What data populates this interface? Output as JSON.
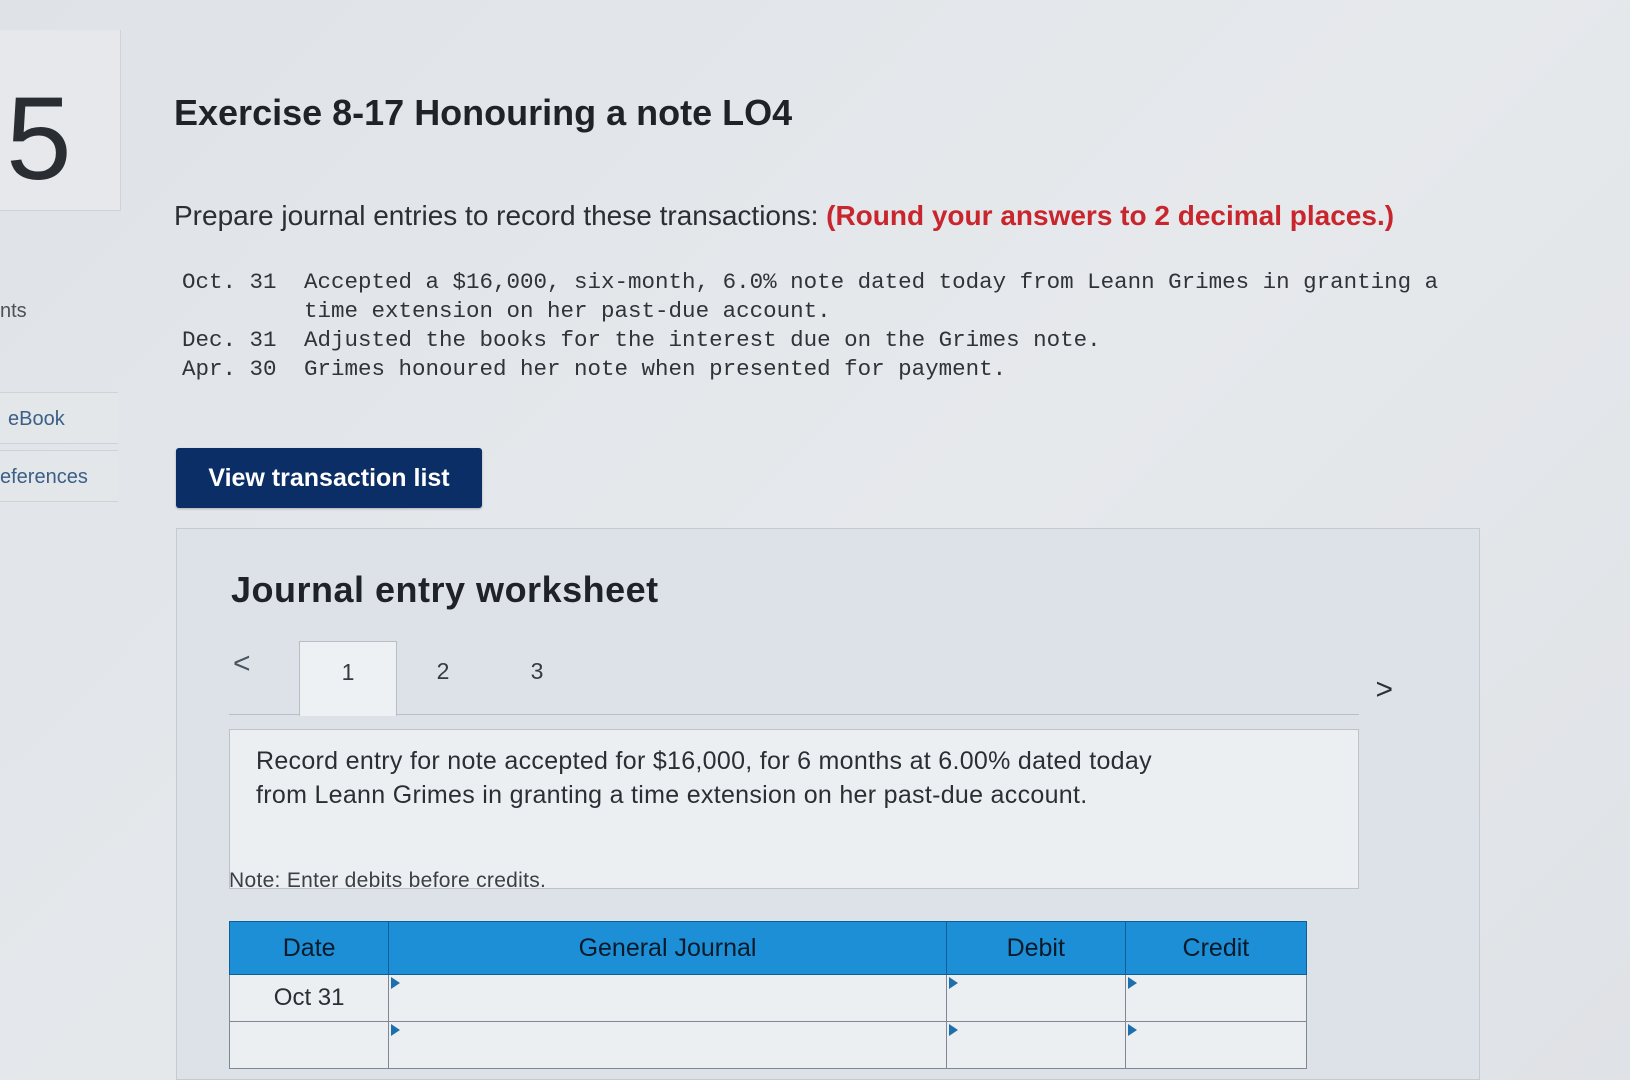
{
  "rail": {
    "question_number": "5",
    "points_label": "nts",
    "ebook_label": "eBook",
    "references_label": "eferences"
  },
  "header": {
    "title": "Exercise 8-17 Honouring a note LO4",
    "instruction": "Prepare journal entries to record these transactions:",
    "instruction_emphasis": "(Round your answers to 2 decimal places.)"
  },
  "transactions": [
    {
      "date": "Oct. 31",
      "description": "Accepted a $16,000, six-month, 6.0% note dated today from Leann Grimes in granting a time extension on her past-due account."
    },
    {
      "date": "Dec. 31",
      "description": "Adjusted the books for the interest due on the Grimes note."
    },
    {
      "date": "Apr. 30",
      "description": "Grimes honoured her note when presented for payment."
    }
  ],
  "buttons": {
    "view_transaction_list": "View transaction list"
  },
  "worksheet": {
    "title": "Journal entry worksheet",
    "prev_icon": "<",
    "next_icon": ">",
    "tabs": [
      "1",
      "2",
      "3"
    ],
    "active_tab": "1",
    "entry_instruction": "Record entry for note accepted for $16,000, for 6 months at 6.00% dated today from Leann Grimes in granting a time extension on her past-due account.",
    "note": "Note: Enter debits before credits.",
    "table": {
      "headers": [
        "Date",
        "General Journal",
        "Debit",
        "Credit"
      ],
      "rows": [
        {
          "date": "Oct 31",
          "account": "",
          "debit": "",
          "credit": ""
        },
        {
          "date": "",
          "account": "",
          "debit": "",
          "credit": ""
        }
      ]
    }
  },
  "colors": {
    "accent_red": "#c8252c",
    "button_navy": "#0c2e66",
    "table_header_blue": "#1d8fd6"
  }
}
